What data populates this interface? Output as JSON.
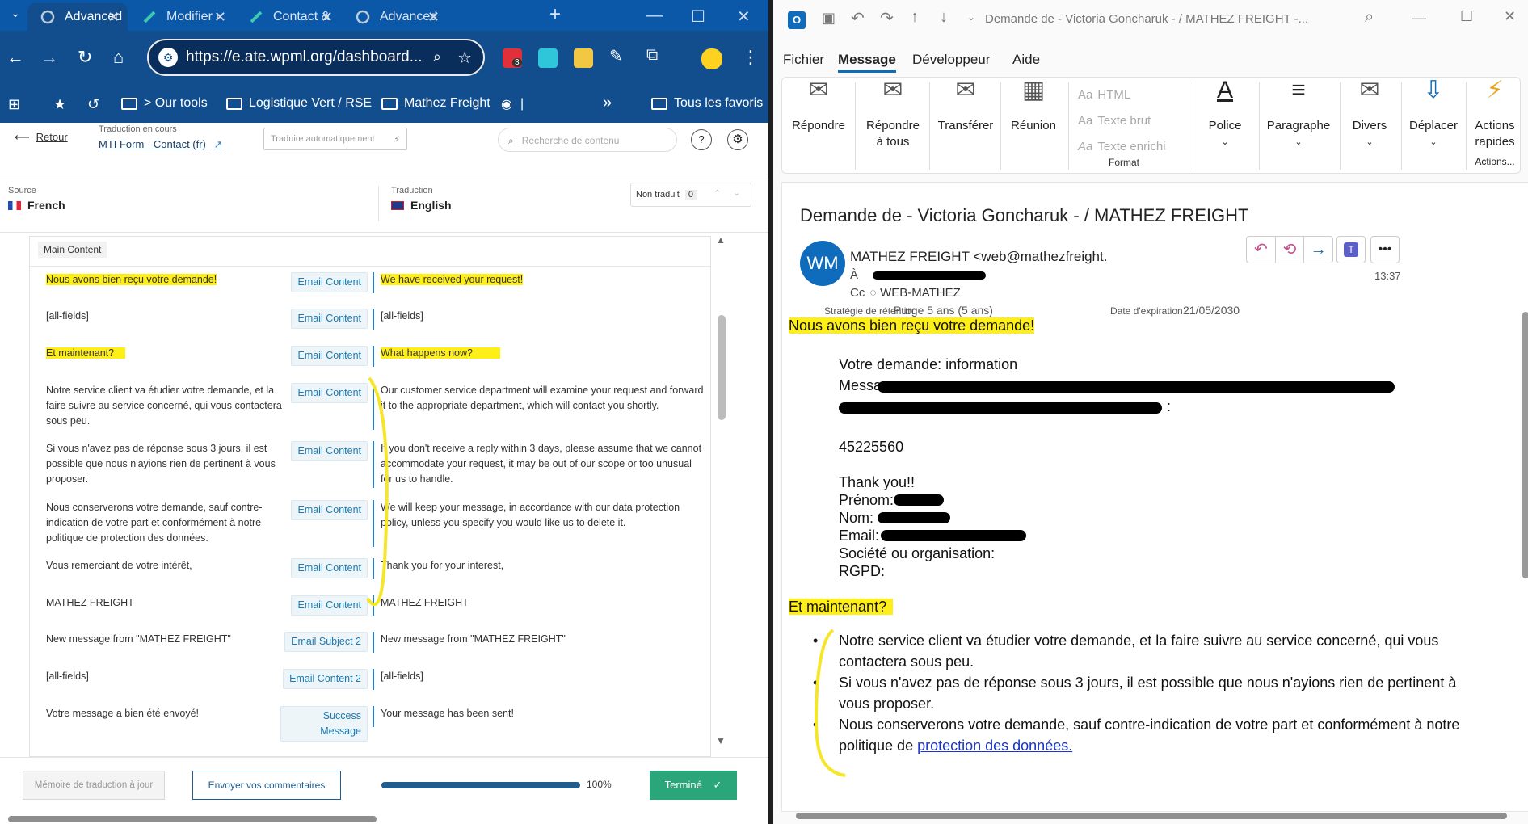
{
  "browser": {
    "tabs": [
      {
        "label": "Advanced"
      },
      {
        "label": "Modifier «"
      },
      {
        "label": "Contact &"
      },
      {
        "label": "Advanced"
      }
    ],
    "url": "https://e.ate.wpml.org/dashboard...",
    "ext_badge": "3",
    "bookmarks": [
      "> Our tools",
      "Logistique Vert / RSE",
      "Mathez Freight",
      "|",
      "»",
      "Tous les favoris"
    ]
  },
  "wpml": {
    "back": "Retour",
    "in_progress_label": "Traduction en cours",
    "job_title": "MTI Form - Contact (fr)",
    "auto_translate": "Traduire automatiquement",
    "search_placeholder": "Recherche de contenu",
    "source_label": "Source",
    "source_lang": "French",
    "target_label": "Traduction",
    "target_lang": "English",
    "filter_label": "Non traduit",
    "filter_count": "0",
    "section_label": "Main Content",
    "rows": [
      {
        "src": "Nous avons bien reçu votre demande!",
        "tag": "Email Content",
        "dst": "We have received your request!"
      },
      {
        "src": "[all-fields]",
        "tag": "Email Content",
        "dst": "[all-fields]"
      },
      {
        "src": "Et maintenant?",
        "tag": "Email Content",
        "dst": "What happens now?"
      },
      {
        "src": "Notre service client va étudier votre demande, et la faire suivre au service concerné, qui vous contactera sous peu.",
        "tag": "Email Content",
        "dst": "Our customer service department will examine your request and forward it to the appropriate department, which will contact you shortly."
      },
      {
        "src": "Si vous n'avez pas de réponse sous 3 jours, il est possible que nous n'ayions rien de pertinent à vous proposer.",
        "tag": "Email Content",
        "dst": "If you don't receive a reply within 3 days, please assume that we cannot accommodate your request, it may be out of our scope or too unusual for us to handle."
      },
      {
        "src": "Nous conserverons votre demande, sauf contre-indication de votre part et conformément à notre politique de protection des données.",
        "tag": "Email Content",
        "dst": "We will keep your message, in accordance with our data protection policy, unless you specify you would like us to delete it."
      },
      {
        "src": "Vous remerciant de votre intérêt,",
        "tag": "Email Content",
        "dst": "Thank you for your interest,"
      },
      {
        "src": "MATHEZ FREIGHT",
        "tag": "Email Content",
        "dst": "MATHEZ FREIGHT"
      },
      {
        "src": "New message from \"MATHEZ FREIGHT\"",
        "tag": "Email Subject 2",
        "dst": "New message from \"MATHEZ FREIGHT\""
      },
      {
        "src": "[all-fields]",
        "tag": "Email Content 2",
        "dst": "[all-fields]"
      },
      {
        "src": "Votre message a bien été envoyé!",
        "tag": "Success Message",
        "dst": "Your message has been sent!"
      }
    ],
    "footer": {
      "memory_button": "Mémoire de traduction à jour",
      "feedback_button": "Envoyer vos commentaires",
      "progress": 100,
      "progress_text": "100%",
      "done_button": "Terminé"
    }
  },
  "outlook": {
    "title": "Demande de  - Victoria Goncharuk -  / MATHEZ FREIGHT  -...",
    "menu": [
      "Fichier",
      "Message",
      "Développeur",
      "Aide"
    ],
    "ribbon": {
      "reply": "Répondre",
      "reply_all_1": "Répondre",
      "reply_all_2": "à tous",
      "forward": "Transférer",
      "meeting": "Réunion",
      "html": "HTML",
      "plain": "Texte brut",
      "rich": "Texte enrichi",
      "format": "Format",
      "font": "Police",
      "paragraph": "Paragraphe",
      "misc": "Divers",
      "move": "Déplacer",
      "actions_1": "Actions",
      "actions_2": "rapides",
      "actions_group": "Actions..."
    },
    "subject": "Demande de  - Victoria Goncharuk -  / MATHEZ FREIGHT",
    "avatar": "WM",
    "sender": "MATHEZ FREIGHT <web@mathezfreight.",
    "to_label": "À",
    "cc_label": "Cc",
    "cc_value": "WEB-MATHEZ",
    "time": "13:37",
    "retention_label": "Stratégie de rétention",
    "retention_value": "Purge 5 ans (5 ans)",
    "expiry_label": "Date d'expiration",
    "expiry_value": "21/05/2030",
    "body": {
      "heading": "Nous avons bien reçu votre demande!",
      "request_line": "Votre demande: information",
      "message_label": "Message:",
      "message_end": ":",
      "number": "45225560",
      "thanks": "Thank you!!",
      "first_name": "Prénom:",
      "last_name": "Nom:",
      "email": "Email:",
      "company": "Société ou organisation:",
      "gdpr": "RGPD:",
      "heading2": "Et maintenant?",
      "b1": "Notre service client va étudier votre demande, et la faire suivre au service concerné, qui vous contactera sous peu.",
      "b2": "Si vous n'avez pas de réponse sous 3 jours, il est possible que nous n'ayions rien de pertinent à vous proposer.",
      "b3_pre": "Nous conserverons votre demande, sauf contre-indication de votre part et conformément à notre politique de ",
      "b3_link": "protection des données."
    }
  },
  "colors": {
    "highlight": "#ffef19",
    "accent": "#2a7dc3",
    "done": "#2ba57a",
    "chrome": "#124e8e"
  }
}
